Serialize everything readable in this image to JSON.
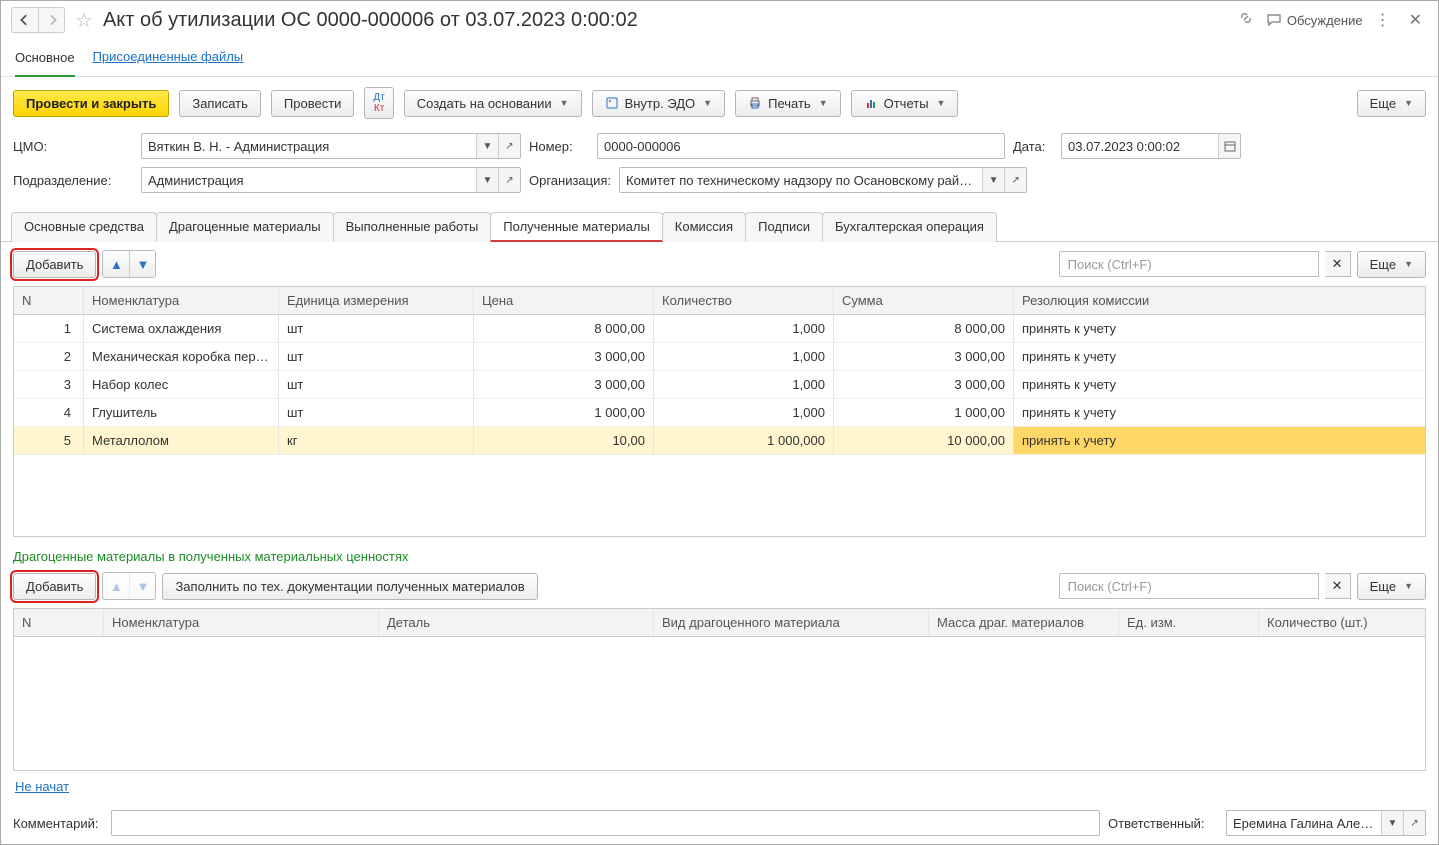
{
  "titlebar": {
    "title": "Акт об утилизации ОС 0000-000006 от 03.07.2023 0:00:02",
    "discuss_label": "Обсуждение"
  },
  "topnav": {
    "main": "Основное",
    "files": "Присоединенные файлы"
  },
  "toolbar": {
    "post_close": "Провести и закрыть",
    "save": "Записать",
    "post": "Провести",
    "create_based": "Создать на основании",
    "edo": "Внутр. ЭДО",
    "print": "Печать",
    "reports": "Отчеты",
    "more": "Еще"
  },
  "form": {
    "cmo_label": "ЦМО:",
    "cmo_value": "Вяткин В. Н. - Администрация",
    "number_label": "Номер:",
    "number_value": "0000-000006",
    "date_label": "Дата:",
    "date_value": "03.07.2023  0:00:02",
    "dept_label": "Подразделение:",
    "dept_value": "Администрация",
    "org_label": "Организация:",
    "org_value": "Комитет по техническому надзору по Осановскому району"
  },
  "tabs": {
    "t0": "Основные средства",
    "t1": "Драгоценные материалы",
    "t2": "Выполненные работы",
    "t3": "Полученные материалы",
    "t4": "Комиссия",
    "t5": "Подписи",
    "t6": "Бухгалтерская операция"
  },
  "table1": {
    "add": "Добавить",
    "search_placeholder": "Поиск (Ctrl+F)",
    "more": "Еще",
    "headers": {
      "n": "N",
      "nom": "Номенклатура",
      "unit": "Единица измерения",
      "price": "Цена",
      "qty": "Количество",
      "sum": "Сумма",
      "res": "Резолюция комиссии"
    },
    "rows": [
      {
        "n": "1",
        "nom": "Система охлаждения",
        "unit": "шт",
        "price": "8 000,00",
        "qty": "1,000",
        "sum": "8 000,00",
        "res": "принять к учету"
      },
      {
        "n": "2",
        "nom": "Механическая коробка пере...",
        "unit": "шт",
        "price": "3 000,00",
        "qty": "1,000",
        "sum": "3 000,00",
        "res": "принять к учету"
      },
      {
        "n": "3",
        "nom": "Набор колес",
        "unit": "шт",
        "price": "3 000,00",
        "qty": "1,000",
        "sum": "3 000,00",
        "res": "принять к учету"
      },
      {
        "n": "4",
        "nom": "Глушитель",
        "unit": "шт",
        "price": "1 000,00",
        "qty": "1,000",
        "sum": "1 000,00",
        "res": "принять к учету"
      },
      {
        "n": "5",
        "nom": "Металлолом",
        "unit": "кг",
        "price": "10,00",
        "qty": "1 000,000",
        "sum": "10 000,00",
        "res": "принять к учету"
      }
    ]
  },
  "section2_title": "Драгоценные материалы в полученных материальных ценностях",
  "table2": {
    "add": "Добавить",
    "fill": "Заполнить по тех. документации полученных материалов",
    "search_placeholder": "Поиск (Ctrl+F)",
    "more": "Еще",
    "headers": {
      "n": "N",
      "nom": "Номенклатура",
      "det": "Деталь",
      "vid": "Вид драгоценного материала",
      "mass": "Масса драг. материалов",
      "um": "Ед. изм.",
      "qty": "Количество (шт.)"
    }
  },
  "status_link": "Не начат",
  "footer": {
    "comment_label": "Комментарий:",
    "comment_value": "",
    "resp_label": "Ответственный:",
    "resp_value": "Еремина Галина Алексан"
  }
}
